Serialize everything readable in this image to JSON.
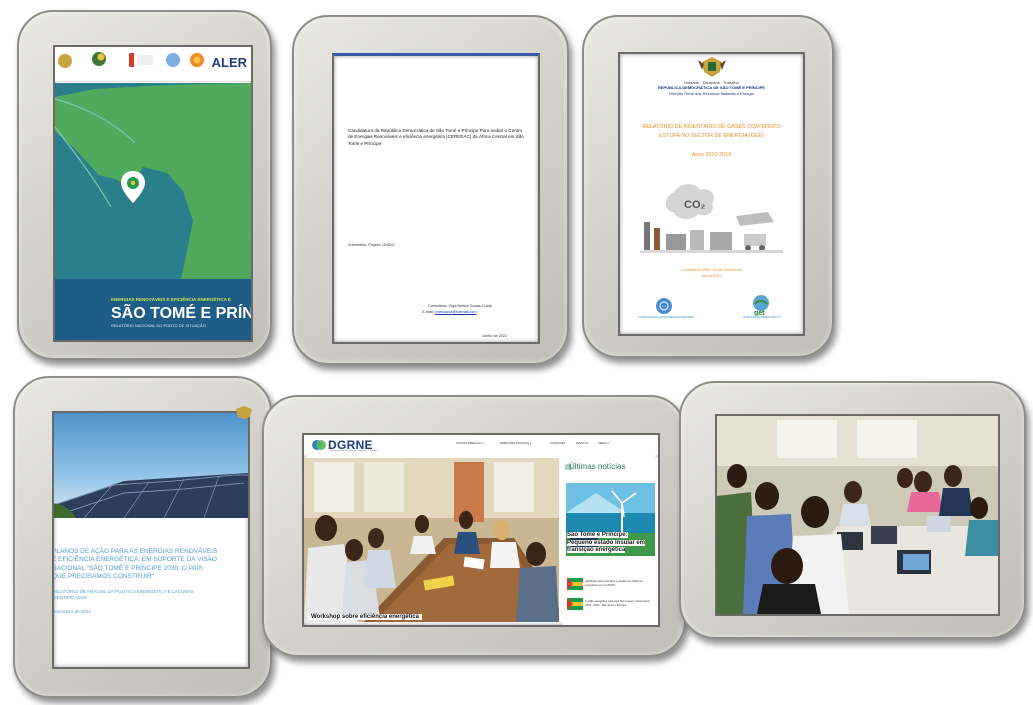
{
  "card1": {
    "aler_logo": "ALER",
    "cover_line1": "ENERGIAS RENOVÁVEIS E EFICIÊNCIA ENERGÉTICA E",
    "cover_title": "SÃO TOMÉ E PRÍNCIP",
    "cover_line3": "RELATÓRIO NACIONAL DO PONTO DE SITUAÇÃO"
  },
  "card2": {
    "title": "Candidatura da República Democrática de São Tomé e Príncipe Para sediar o Centro de Energias Renováveis e eficiência energética (CEREEAC) da África Central em São Tomé e Príncipe",
    "submission": "Submetido: Projeto: UNIDO",
    "consultant": "Consultora: Giga Neilice Sousa Costa",
    "email_label": "E-mail:",
    "email_value": "eneisousa@hotmail.com",
    "date": "Junho de 2022"
  },
  "card3": {
    "header1": "Unidade · Disciplina · Trabalho",
    "header2": "REPÚBLICA DEMOCRÁTICA DE SÃO TOMÉ E PRÍNCIPE",
    "header3": "Direção Geral dos Recursos Naturais e Energia",
    "title1": "RELATÓRIO DE INVENTÁRIO DE GASES COM EFEITO",
    "title2": "ESTUFA NO SECTOR DE ENERGIA (GEE)",
    "years": "Anos 2010-2019",
    "co2": "CO₂",
    "consultant": "Consultora: MSc. Sónia Quaresma",
    "date": "Junho 2021",
    "un_caption": "UNITED NATIONS ENVIRONMENT PROGRAMME",
    "get_label": "get",
    "get_caption": "GLOBAL ENVIRONMENT FACILITY"
  },
  "card4": {
    "title": "PLANOS DE AÇÃO PARA AS ENERGIAS RENOVÁVEIS\nE EFICIÊNCIA ENERGÉTICA, EM SUPORTE DA VISÃO\nNACIONAL \"SÃO TOMÉ E PRÍNCIPE 2030: O PAÍS\nQUE PRECISAMOS CONSTRUIR\"",
    "subtitle": "RELATÓRIO DE ANÁLISE DA POLÍTICA ENERGÉTICA E LACUNAS\nIDENTIFICADAS",
    "date": "Dezembro de 2021"
  },
  "card5": {
    "logo": "DGRNE",
    "tagline": "Direcção Geral dos Recursos Naturais e Energia",
    "nav": [
      "A NOSSA DIRECÇÃO ▾",
      "DIRECÇÕES TÉCNICAS ▾",
      "NOVIDADES",
      "EVENTOS",
      "ÁREAS ▾"
    ],
    "photo_caption": "Workshop sobre eficiência energética",
    "latest_label": "Últimas notícias",
    "news_title": "São Tomé e Príncipe: Pequeno estado insular em transição energética",
    "item1": "Validação para Inventário e análise de eficiência energética com a UNIDO",
    "item2": "A visão energética e Energia Renovável e Sustentável 2019 - 2030 - São Tomé e Príncipe"
  },
  "colors": {
    "frame": "#d3d2cb",
    "ocean": "#2b7f8c",
    "land": "#4faa5e",
    "cover_band": "#1e5d86",
    "dgrne_blue": "#1c3f7a",
    "orange_title": "#e88b2b",
    "report_blue": "#4a9ed2"
  }
}
